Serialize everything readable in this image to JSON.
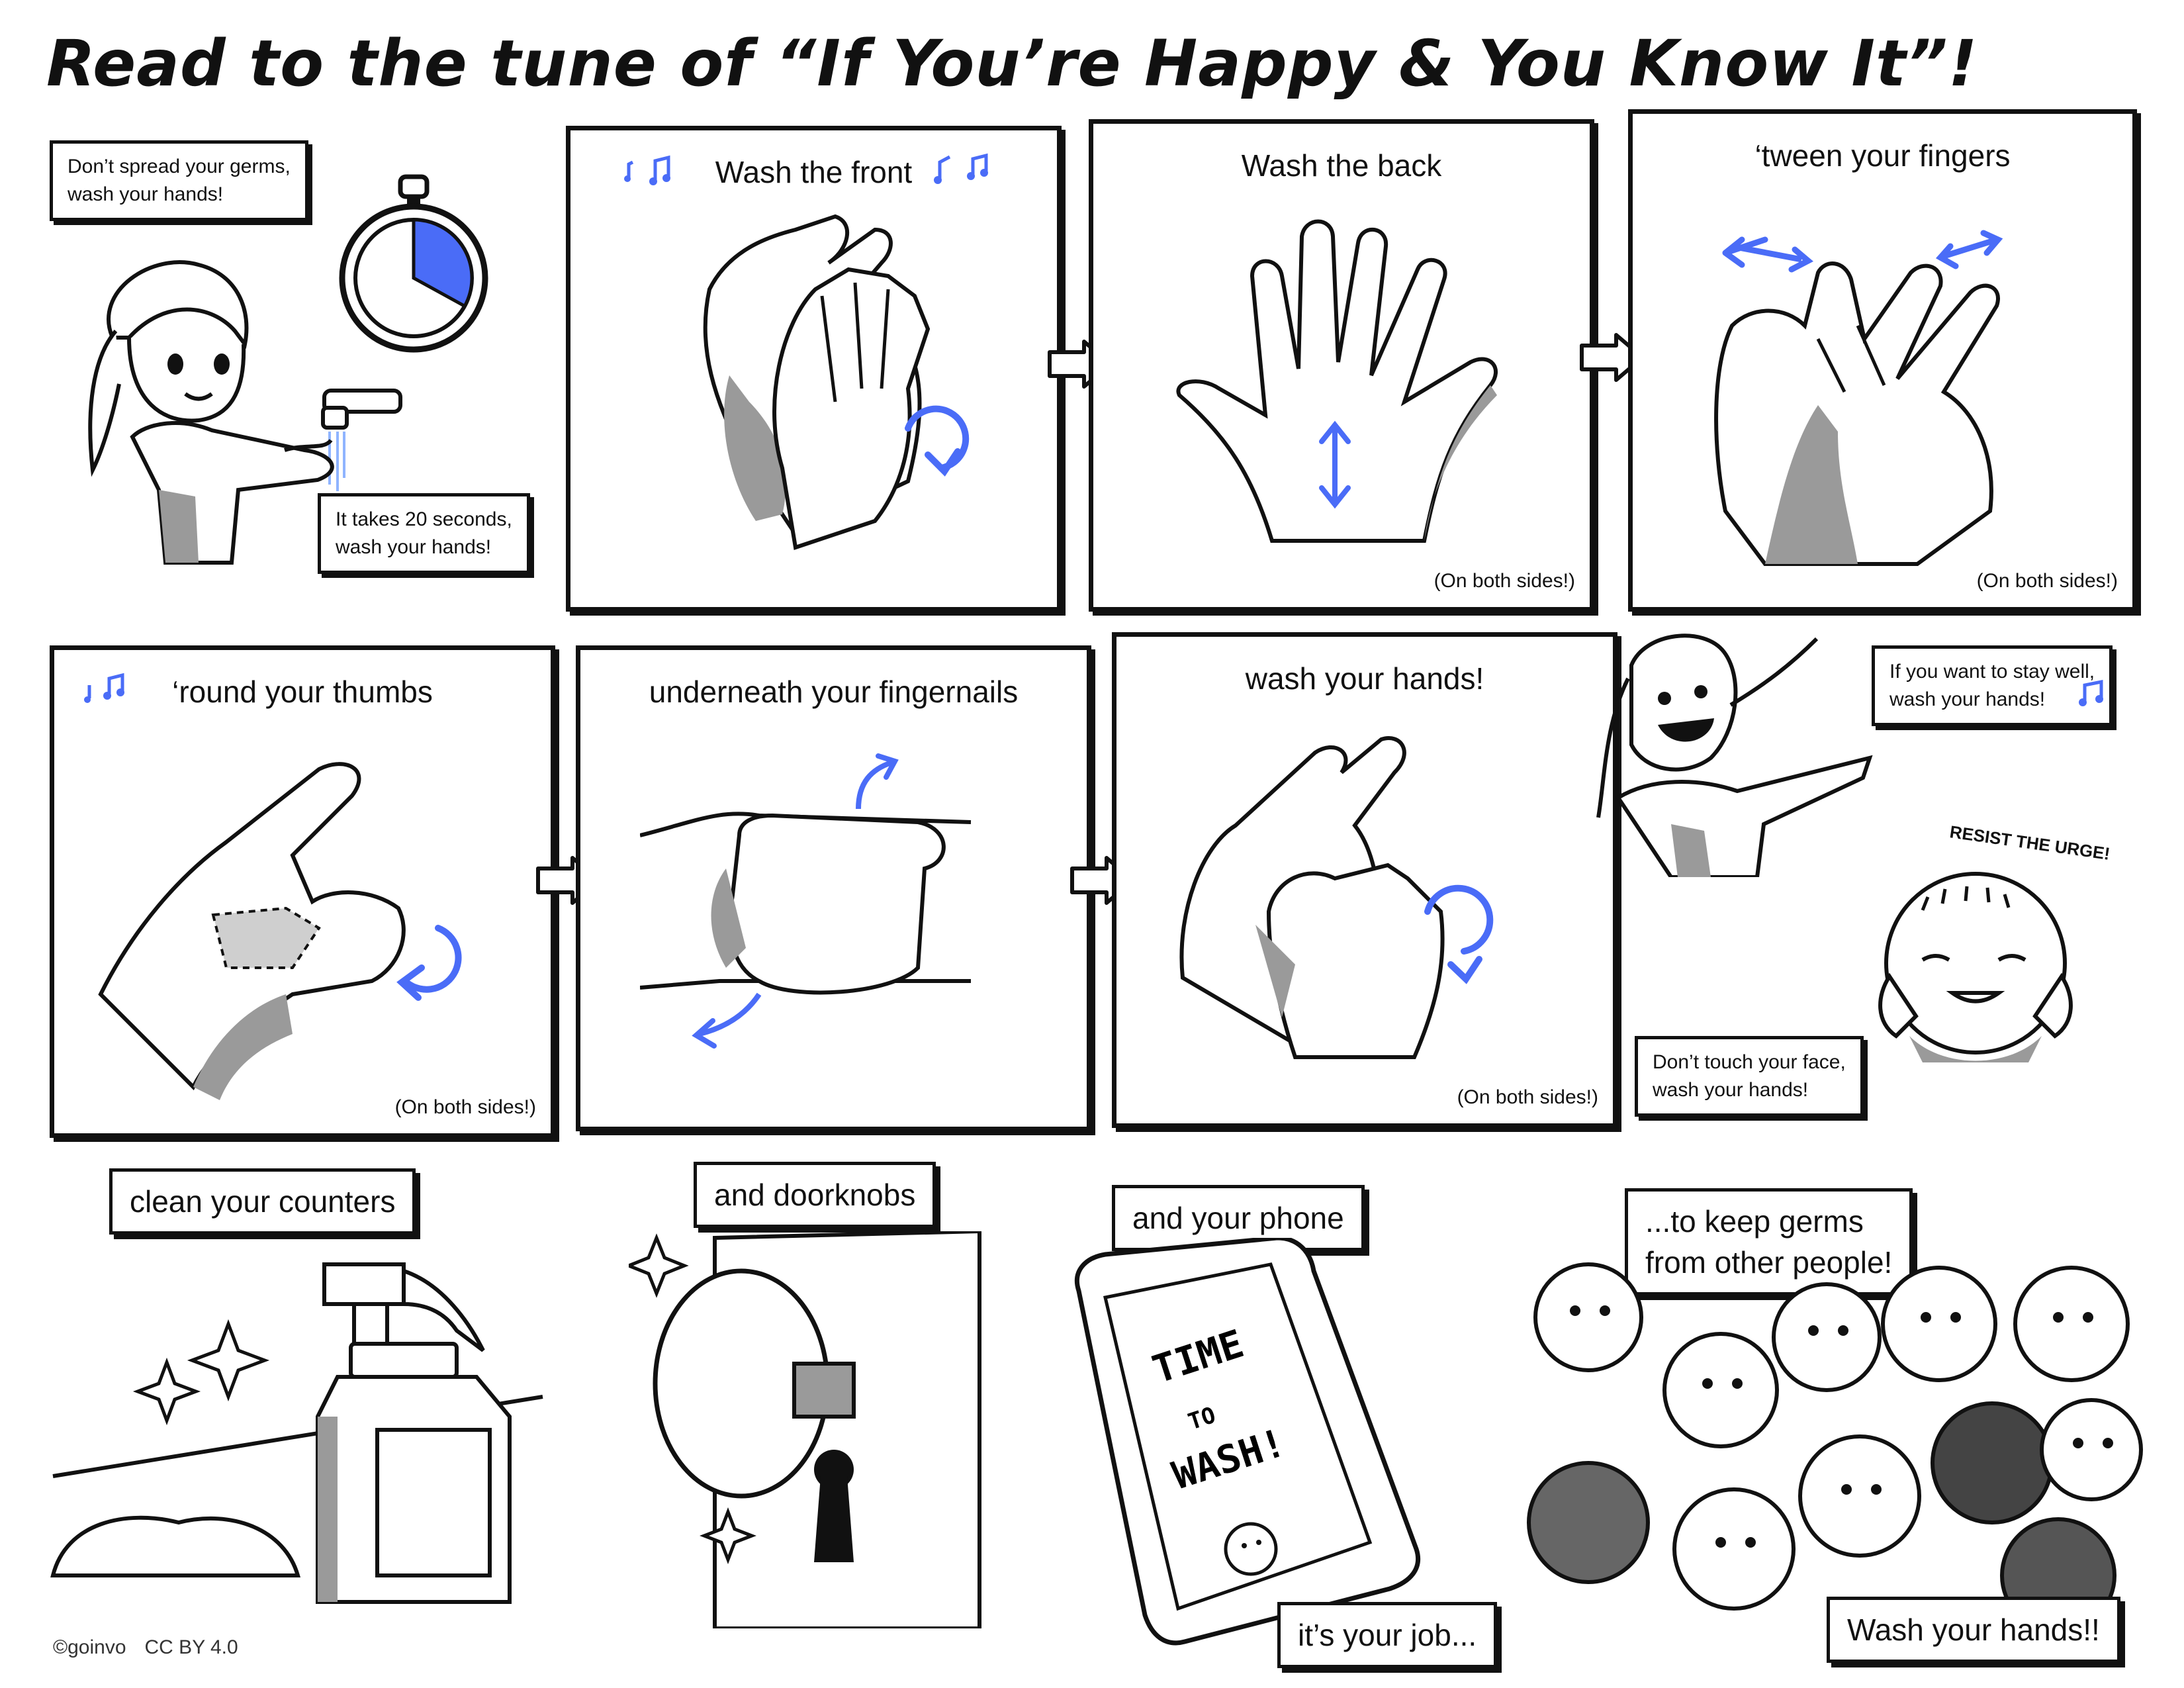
{
  "title": "Read to the tune of “If You’re Happy & You Know It”!",
  "colors": {
    "accent": "#4a6cf7",
    "ink": "#111111",
    "shadow": "#9a9a9a"
  },
  "intro": {
    "caption_top": [
      "Don’t spread your germs,",
      "wash your hands!"
    ],
    "caption_bottom": [
      "It takes 20 seconds,",
      "wash your hands!"
    ],
    "timer_fraction": 0.33
  },
  "steps": [
    {
      "title": "Wash the front",
      "note": ""
    },
    {
      "title": "Wash the back",
      "note": "(On both sides!)"
    },
    {
      "title": "‘tween your fingers",
      "note": "(On both sides!)"
    },
    {
      "title": "‘round your thumbs",
      "note": "(On both sides!)"
    },
    {
      "title": "underneath your fingernails",
      "note": ""
    },
    {
      "title": "wash your hands!",
      "note": "(On both sides!)"
    }
  ],
  "side": {
    "caption_stay_well": [
      "If you want to stay well,",
      "wash your hands!"
    ],
    "resist_label": "RESIST THE URGE!",
    "caption_face": [
      "Don’t touch your face,",
      "wash your hands!"
    ]
  },
  "bottom": {
    "counters": "clean your counters",
    "doorknobs": "and doorknobs",
    "phone": "and your phone",
    "phone_screen": [
      "TIME",
      "TO",
      "WASH!"
    ],
    "job": "it’s your job...",
    "keep_germs": [
      "...to keep germs",
      "from other people!"
    ],
    "finale": "Wash your hands!!"
  },
  "footer": {
    "credit": "©goinvo",
    "license": "CC BY 4.0"
  }
}
